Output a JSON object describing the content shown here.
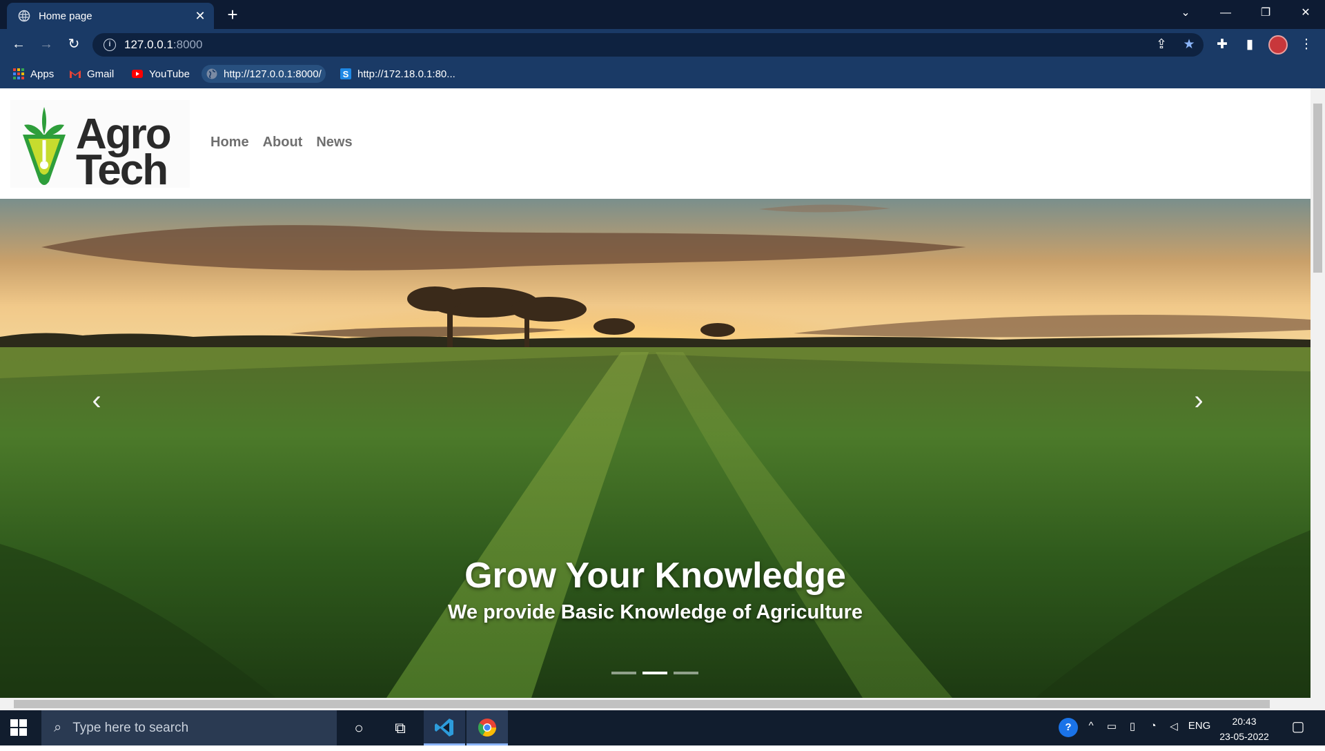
{
  "browser": {
    "tab_title": "Home page",
    "new_tab_label": "+",
    "url_host": "127.0.0.1",
    "url_port": ":8000",
    "bookmarks": [
      {
        "label": "Apps",
        "icon": "apps-grid-icon"
      },
      {
        "label": "Gmail",
        "icon": "gmail-icon"
      },
      {
        "label": "YouTube",
        "icon": "youtube-icon"
      },
      {
        "label": "http://127.0.0.1:8000/",
        "icon": "globe-icon"
      },
      {
        "label": "http://172.18.0.1:80...",
        "icon": "s-icon"
      }
    ]
  },
  "site": {
    "logo_text_line1": "Agro",
    "logo_text_line2": "Tech",
    "nav": [
      {
        "label": "Home"
      },
      {
        "label": "About"
      },
      {
        "label": "News"
      }
    ],
    "carousel": {
      "title": "Grow Your Knowledge",
      "subtitle": "We provide Basic Knowledge of Agriculture",
      "prev_glyph": "‹",
      "next_glyph": "›",
      "slide_count": 3,
      "active_slide": 2
    }
  },
  "taskbar": {
    "search_placeholder": "Type here to search",
    "language": "ENG",
    "time": "20:43",
    "date": "23-05-2022"
  },
  "colors": {
    "tab_bar": "#0d1b33",
    "toolbar": "#1a3a66",
    "nav_link": "#6f6f6f",
    "logo_green": "#2e9e3b",
    "logo_lime": "#c6dc2e",
    "logo_text": "#2a2a2a"
  }
}
